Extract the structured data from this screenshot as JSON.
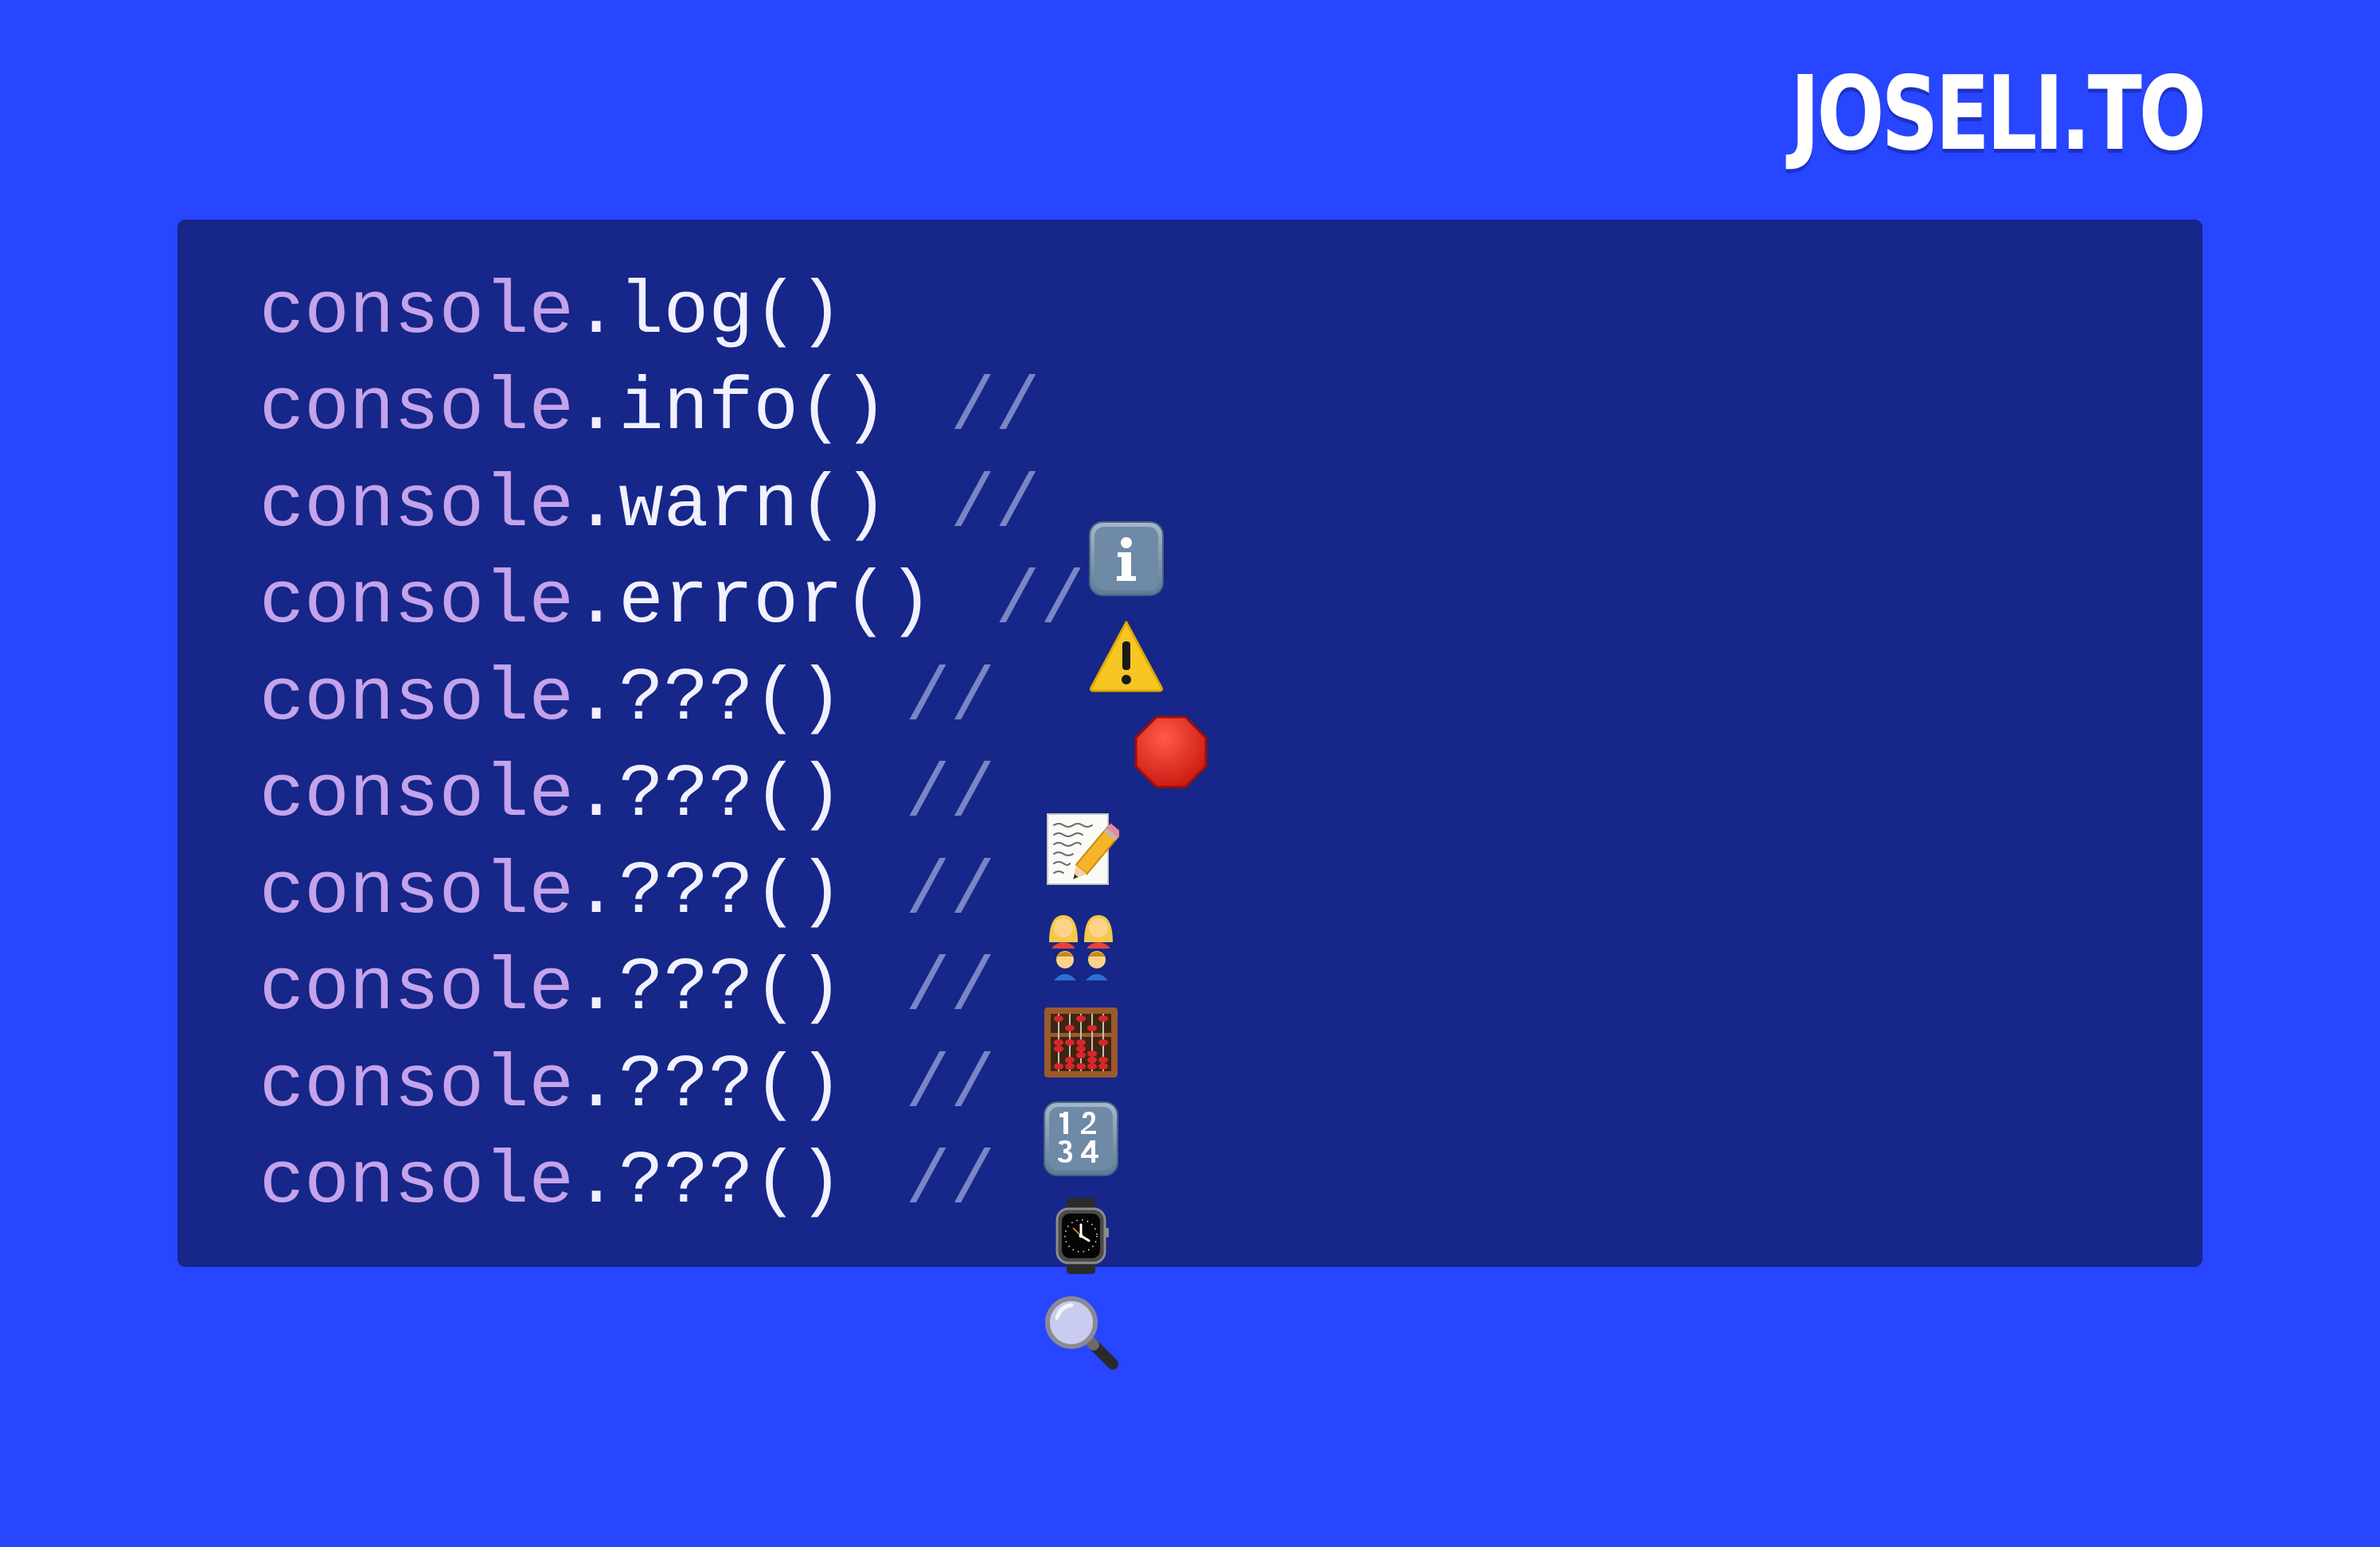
{
  "brand": {
    "name": "JOSELI.TO"
  },
  "colors": {
    "background": "#2845ff",
    "panel": "#162689",
    "object_text": "#c4a3ea",
    "method_text": "#f1f1ff",
    "comment_text": "#7a86c4"
  },
  "code": {
    "lines": [
      {
        "object": "console",
        "dot": ".",
        "method": "log",
        "parens": "()",
        "comment": "",
        "icon": ""
      },
      {
        "object": "console",
        "dot": ".",
        "method": "info",
        "parens": "()",
        "comment": "//",
        "icon": "information-icon"
      },
      {
        "object": "console",
        "dot": ".",
        "method": "warn",
        "parens": "()",
        "comment": "//",
        "icon": "warning-icon"
      },
      {
        "object": "console",
        "dot": ".",
        "method": "error",
        "parens": "()",
        "comment": "//",
        "icon": "stop-sign-icon"
      },
      {
        "object": "console",
        "dot": ".",
        "method": "???",
        "parens": "()",
        "comment": "//",
        "icon": "memo-icon"
      },
      {
        "object": "console",
        "dot": ".",
        "method": "???",
        "parens": "()",
        "comment": "//",
        "icon": "family-icon"
      },
      {
        "object": "console",
        "dot": ".",
        "method": "???",
        "parens": "()",
        "comment": "//",
        "icon": "abacus-icon"
      },
      {
        "object": "console",
        "dot": ".",
        "method": "???",
        "parens": "()",
        "comment": "//",
        "icon": "numbers-1234-icon"
      },
      {
        "object": "console",
        "dot": ".",
        "method": "???",
        "parens": "()",
        "comment": "//",
        "icon": "watch-icon"
      },
      {
        "object": "console",
        "dot": ".",
        "method": "???",
        "parens": "()",
        "comment": "//",
        "icon": "magnifying-glass-icon"
      }
    ]
  }
}
